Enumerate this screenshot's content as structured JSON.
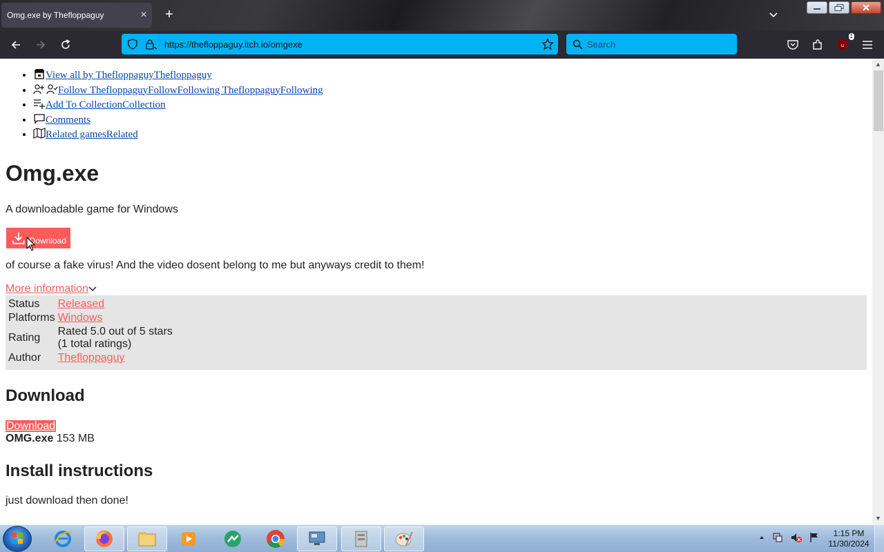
{
  "browser": {
    "tab_title": "Omg.exe by Thefloppaguy",
    "tab_close": "×",
    "new_tab": "+",
    "url": "https://thefloppaguy.itch.io/omgexe",
    "search_placeholder": "Search",
    "extension_badge": "1"
  },
  "user_tools": [
    {
      "label": "View all by ThefloppaguyThefloppaguy",
      "icon": "itchio-icon"
    },
    {
      "label": "Follow ThefloppaguyFollowFollowing ThefloppaguyFollowing",
      "icon": "follow-user-icon"
    },
    {
      "label": "Add To CollectionCollection",
      "icon": "add-collection-icon"
    },
    {
      "label": "Comments",
      "icon": "comment-icon"
    },
    {
      "label": "Related gamesRelated",
      "icon": "map-icon"
    }
  ],
  "game": {
    "title": "Omg.exe",
    "subtitle": "A downloadable game for Windows",
    "download_button": "Download",
    "description": "of course a fake virus! And the video dosent belong to me but anyways credit to them!",
    "more_info": "More information",
    "info": {
      "status_label": "Status",
      "status_value": "Released",
      "platforms_label": "Platforms",
      "platforms_value": "Windows",
      "rating_label": "Rating",
      "rating_line1": "Rated 5.0 out of 5 stars",
      "rating_line2": "(1 total ratings)",
      "author_label": "Author",
      "author_value": "Thefloppaguy"
    },
    "download_heading": "Download",
    "download_link": "Download",
    "file_name": "OMG.exe",
    "file_size": "153 MB",
    "install_heading": "Install instructions",
    "install_text": "just download then done!"
  },
  "taskbar": {
    "time": "1:15 PM",
    "date": "11/30/2024",
    "apps": [
      "internet-explorer-icon",
      "firefox-icon",
      "file-explorer-icon",
      "media-player-icon",
      "messenger-icon",
      "chrome-icon",
      "remote-desktop-icon",
      "archive-icon",
      "paint-icon"
    ]
  },
  "colors": {
    "accent": "#fa5c5c",
    "urlbar": "#00b3f4",
    "toolbar": "#2b2a33",
    "info_panel": "#e5e5e5"
  }
}
